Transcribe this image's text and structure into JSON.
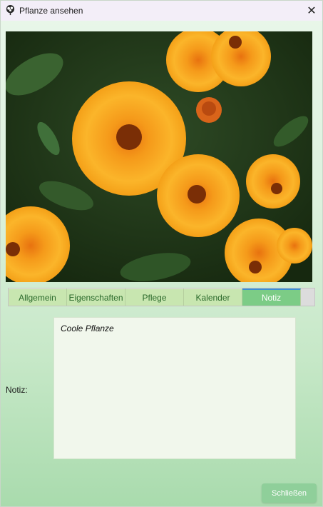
{
  "window": {
    "title": "Pflanze ansehen",
    "close_glyph": "✕",
    "app_icon": "tree-icon"
  },
  "photo": {
    "description_icon": "plant-photo"
  },
  "tabs": [
    {
      "label": "Allgemein",
      "active": false
    },
    {
      "label": "Eigenschaften",
      "active": false
    },
    {
      "label": "Pflege",
      "active": false
    },
    {
      "label": "Kalender",
      "active": false
    },
    {
      "label": "Notiz",
      "active": true
    }
  ],
  "note": {
    "label": "Notiz:",
    "value": "Coole Pflanze"
  },
  "footer": {
    "close_label": "Schließen"
  },
  "colors": {
    "tab_active": "#7ccc86",
    "tab_inactive": "#c8e6b0",
    "button": "#8fcf9a",
    "accent": "#3b8fd6"
  }
}
